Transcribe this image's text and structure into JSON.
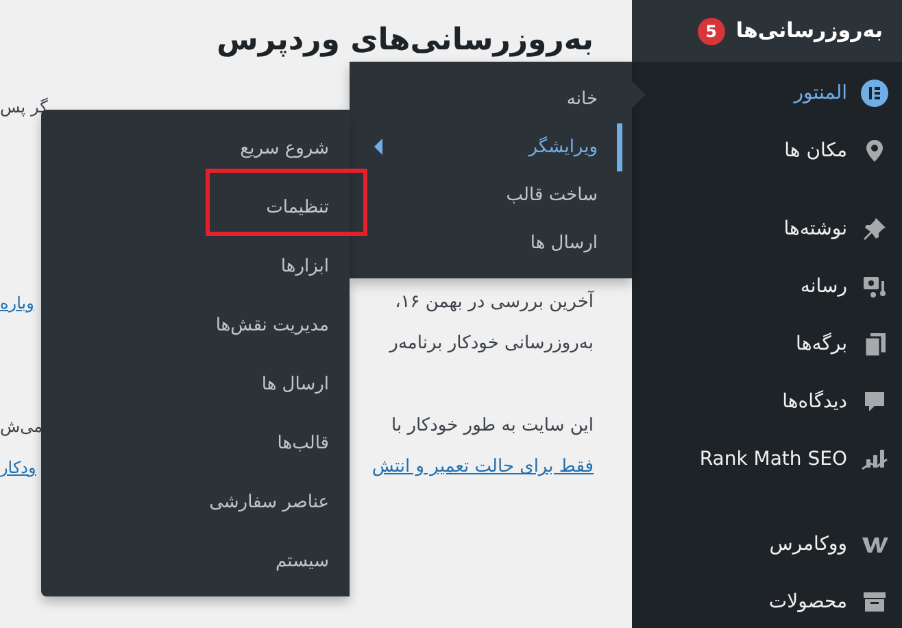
{
  "content": {
    "title": "به‌روزرسانی‌های وردپرس",
    "paragraphs": [
      [
        {
          "end": {
            "text": "گر پس",
            "link": false
          }
        }
      ],
      [
        {
          "start": {
            "text": "آخرین بررسی در بهمن ۱۶،",
            "link": false
          },
          "end": {
            "text": "وباره",
            "link": true
          }
        },
        {
          "start": {
            "text": "به‌روزرسانی خودکار برنامه‌ر",
            "link": false
          }
        }
      ],
      [
        {
          "start": {
            "text": "این سایت به طور خودکار با",
            "link": false
          },
          "end": {
            "text": "می‌ش",
            "link": false
          }
        },
        {
          "start": {
            "text": "فقط برای حالت تعمیر و انتش",
            "link": true
          },
          "end": {
            "text": "ودکار",
            "link": true
          }
        }
      ]
    ]
  },
  "sidebar": {
    "updates": {
      "label": "به‌روزرسانی‌ها",
      "badge": "5"
    },
    "groups": [
      [
        {
          "label": "المنتور",
          "selected": true
        },
        {
          "label": "مکان ها",
          "selected": false
        }
      ],
      [
        {
          "label": "نوشته‌ها",
          "selected": false
        },
        {
          "label": "رسانه",
          "selected": false
        },
        {
          "label": "برگه‌ها",
          "selected": false
        },
        {
          "label": "دیدگاه‌ها",
          "selected": false
        },
        {
          "label": "Rank Math SEO",
          "selected": false
        }
      ],
      [
        {
          "label": "ووکامرس",
          "selected": false
        },
        {
          "label": "محصولات",
          "selected": false
        }
      ]
    ]
  },
  "flyout": {
    "items": [
      {
        "label": "خانه",
        "selected": false
      },
      {
        "label": "ویرایشگر",
        "selected": true
      },
      {
        "label": "ساخت قالب",
        "selected": false
      },
      {
        "label": "ارسال ها",
        "selected": false
      }
    ]
  },
  "submenu": {
    "items": [
      {
        "label": "شروع سریع",
        "highlighted": false
      },
      {
        "label": "تنظیمات",
        "highlighted": true
      },
      {
        "label": "ابزارها",
        "highlighted": false
      },
      {
        "label": "مدیریت نقش‌ها",
        "highlighted": false
      },
      {
        "label": "ارسال ها",
        "highlighted": false
      },
      {
        "label": "قالب‌ها",
        "highlighted": false
      },
      {
        "label": "عناصر سفارشی",
        "highlighted": false
      },
      {
        "label": "سیستم",
        "highlighted": false
      }
    ]
  }
}
